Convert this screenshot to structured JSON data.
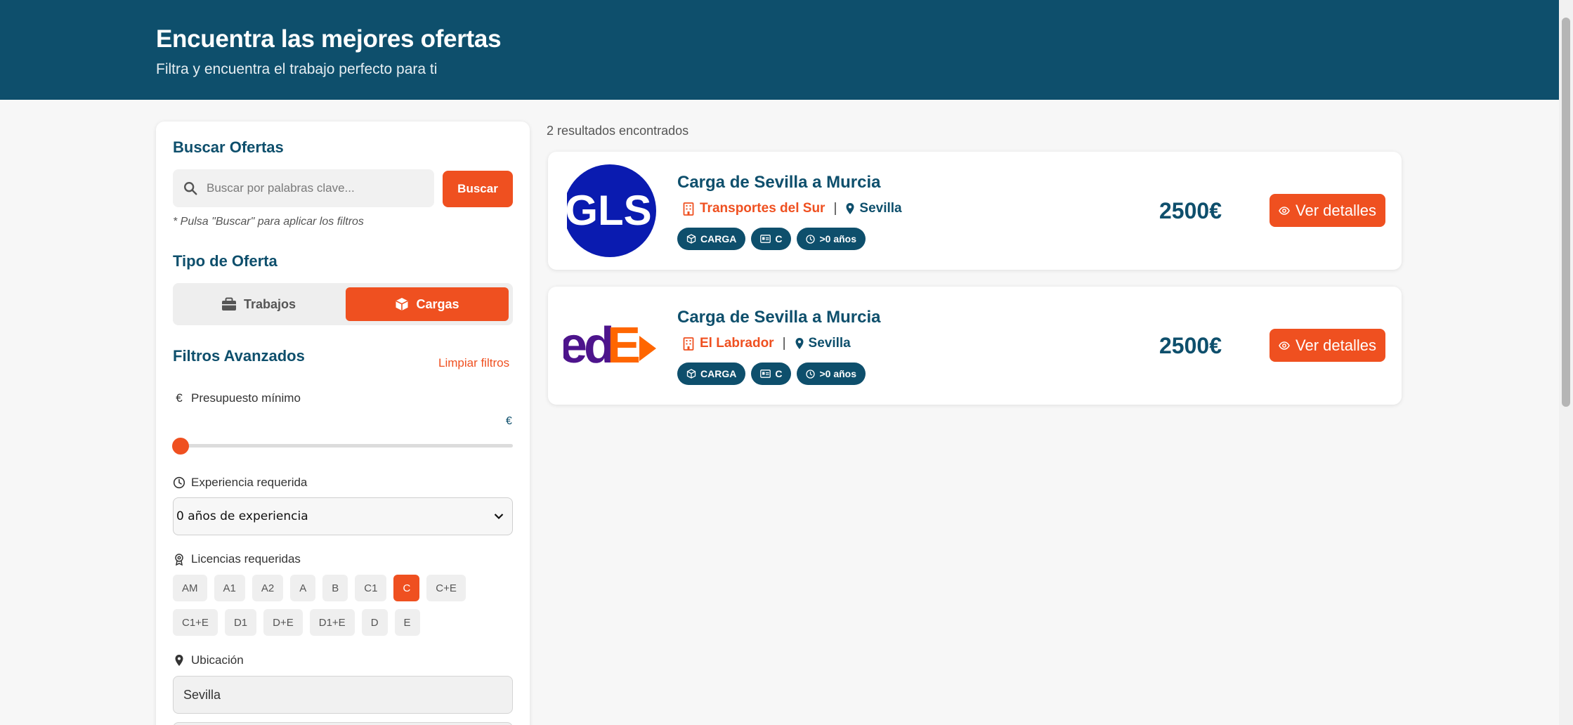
{
  "header": {
    "title": "Encuentra las mejores ofertas",
    "subtitle": "Filtra y encuentra el trabajo perfecto para ti"
  },
  "filters": {
    "search_title": "Buscar Ofertas",
    "search_placeholder": "Buscar por palabras clave...",
    "search_button": "Buscar",
    "search_hint": "* Pulsa \"Buscar\" para aplicar los filtros",
    "type_title": "Tipo de Oferta",
    "type_options": [
      {
        "label": "Trabajos",
        "icon": "briefcase-icon",
        "selected": false
      },
      {
        "label": "Cargas",
        "icon": "box-icon",
        "selected": true
      }
    ],
    "advanced_title": "Filtros Avanzados",
    "clear_label": "Limpiar filtros",
    "budget_label": "Presupuesto mínimo",
    "budget_unit": "€",
    "budget_value_fraction": 0,
    "experience_label": "Experiencia requerida",
    "experience_selected": "0 años de experiencia",
    "licenses_label": "Licencias requeridas",
    "licenses_row1": [
      "AM",
      "A1",
      "A2",
      "A",
      "B",
      "C1",
      "C",
      "C+E"
    ],
    "licenses_row2": [
      "C1+E",
      "D1",
      "D+E",
      "D1+E",
      "D",
      "E"
    ],
    "licenses_selected": [
      "C"
    ],
    "location_label": "Ubicación",
    "location_value": "Sevilla"
  },
  "results": {
    "count_text": "2 resultados encontrados",
    "items": [
      {
        "title": "Carga de Sevilla a Murcia",
        "company": "Transportes del Sur",
        "city": "Sevilla",
        "tags": [
          "CARGA",
          "C",
          ">0 años"
        ],
        "price": "2500€",
        "button": "Ver detalles",
        "logo": "GLS"
      },
      {
        "title": "Carga de Sevilla a Murcia",
        "company": "El Labrador",
        "city": "Sevilla",
        "tags": [
          "CARGA",
          "C",
          ">0 años"
        ],
        "price": "2500€",
        "button": "Ver detalles",
        "logo": "FedEx"
      }
    ]
  },
  "colors": {
    "primary": "#0e4f6c",
    "accent": "#ef5020",
    "background": "#f7f7f7"
  }
}
